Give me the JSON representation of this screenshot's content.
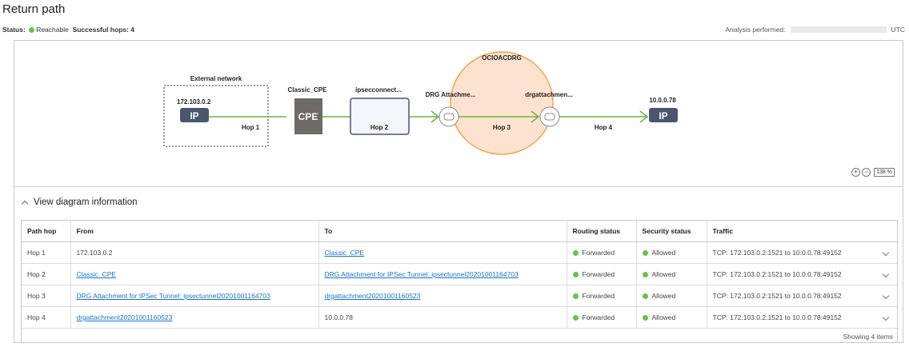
{
  "page": {
    "title": "Return path"
  },
  "status": {
    "label": "Status:",
    "value": "Reachable",
    "hops_label": "Successful hops: 4",
    "analysis_label": "Analysis performed:",
    "analysis_tz": "UTC"
  },
  "diagram": {
    "external_network_label": "External network",
    "source_ip": "172.103.0.2",
    "ip_badge": "IP",
    "cpe_name": "Classic_CPE",
    "cpe_badge": "CPE",
    "ipsec_name": "ipsecconnect...",
    "drg_name": "OCIOACDRG",
    "drg_attach_in": "DRG Attachme...",
    "drg_attach_out": "drgattachmen...",
    "dest_ip": "10.0.0.78",
    "hops": [
      "Hop 1",
      "Hop 2",
      "Hop 3",
      "Hop 4"
    ],
    "zoom_level": "138 %",
    "colors": {
      "link": "#6cb33f",
      "ip_badge": "#4a5670",
      "cpe_badge": "#6e6a66",
      "drg_fill": "#fde3cf",
      "drg_stroke": "#f3a44f"
    }
  },
  "info": {
    "toggle_label": "View diagram information",
    "columns": [
      "Path hop",
      "From",
      "To",
      "Routing status",
      "Security status",
      "Traffic"
    ],
    "rows": [
      {
        "hop": "Hop 1",
        "from": "172.103.0.2",
        "from_link": false,
        "to": "Classic_CPE",
        "to_link": true,
        "routing": "Forwarded",
        "security": "Allowed",
        "traffic": "TCP: 172.103.0.2:1521 to 10.0.0.78:49152"
      },
      {
        "hop": "Hop 2",
        "from": "Classic_CPE",
        "from_link": true,
        "to": "DRG Attachment for IPSec Tunnel: ipsectunnel20201001164703",
        "to_link": true,
        "routing": "Forwarded",
        "security": "Allowed",
        "traffic": "TCP: 172.103.0.2:1521 to 10.0.0.78:49152"
      },
      {
        "hop": "Hop 3",
        "from": "DRG Attachment for IPSec Tunnel: ipsectunnel20201001164703",
        "from_link": true,
        "to": "drgattachment20201001160523",
        "to_link": true,
        "routing": "Forwarded",
        "security": "Allowed",
        "traffic": "TCP: 172.103.0.2:1521 to 10.0.0.78:49152"
      },
      {
        "hop": "Hop 4",
        "from": "drgattachment20201001160523",
        "from_link": true,
        "to": "10.0.0.78",
        "to_link": false,
        "routing": "Forwarded",
        "security": "Allowed",
        "traffic": "TCP: 172.103.0.2:1521 to 10.0.0.78:49152"
      }
    ],
    "footer": "Showing 4 items"
  }
}
